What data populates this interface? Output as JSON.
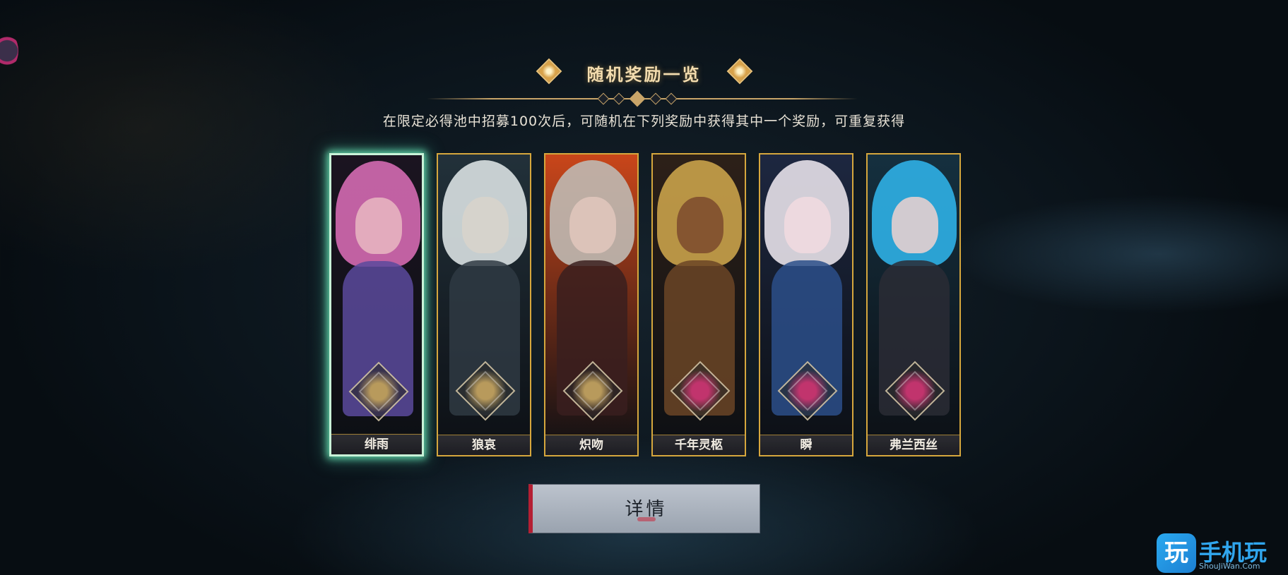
{
  "header": {
    "title": "随机奖励一览",
    "subtitle": "在限定必得池中招募100次后，可随机在下列奖励中获得其中一个奖励，可重复获得"
  },
  "rewards": [
    {
      "name": "绯雨",
      "selected": true,
      "colors": {
        "hair": "#d46ab1",
        "face": "#e9b9c2",
        "body": "#5b4a9c",
        "bg": "#1b1420",
        "emblem": "#b89a5c"
      }
    },
    {
      "name": "狼哀",
      "selected": false,
      "colors": {
        "hair": "#d9e1e2",
        "face": "#d8d3cb",
        "body": "#2f3a43",
        "bg": "#22313a",
        "emblem": "#b89a5c"
      }
    },
    {
      "name": "炽吻",
      "selected": false,
      "colors": {
        "hair": "#bfb9b3",
        "face": "#e2c7bd",
        "body": "#3a1f1e",
        "bg": "#c9461a",
        "emblem": "#b89a5c"
      }
    },
    {
      "name": "千年灵柩",
      "selected": false,
      "colors": {
        "hair": "#c9a24a",
        "face": "#7b4a2d",
        "body": "#6b4526",
        "bg": "#2d2018",
        "emblem": "#c1346d"
      }
    },
    {
      "name": "瞬",
      "selected": false,
      "colors": {
        "hair": "#e7e1e9",
        "face": "#f2dbe0",
        "body": "#2b4f8a",
        "bg": "#1d2740",
        "emblem": "#c1346d"
      }
    },
    {
      "name": "弗兰西丝",
      "selected": false,
      "colors": {
        "hair": "#2fb0e6",
        "face": "#f0d2cf",
        "body": "#2a2b35",
        "bg": "#15303f",
        "emblem": "#c1346d"
      }
    }
  ],
  "actions": {
    "detail_label": "详情"
  },
  "watermark": {
    "icon_char": "玩",
    "text": "手机玩",
    "sub": "ShouJiWan.Com"
  },
  "theme": {
    "accent_gold": "#d6a73d",
    "selected_glow": "#78ffc8",
    "button_stripe": "#b41f33"
  }
}
